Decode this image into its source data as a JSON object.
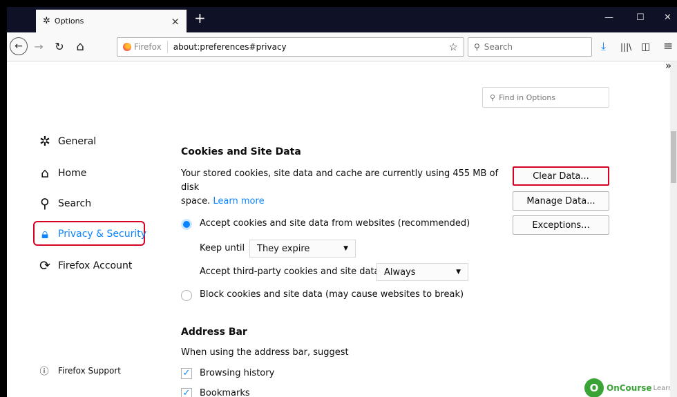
{
  "tab": {
    "icon": "gear-icon",
    "title": "Options",
    "close": "×"
  },
  "newtab": "+",
  "window_controls": {
    "minimize": "—",
    "maximize": "☐",
    "close": "✕"
  },
  "nav": {
    "back": "←",
    "forward": "→",
    "reload": "↻",
    "home": "⌂"
  },
  "urlbar": {
    "identity": "Firefox",
    "url": "about:preferences#privacy",
    "bookmark_star": "☆"
  },
  "searchbar": {
    "placeholder": "Search"
  },
  "toolbar": {
    "download": "⤓",
    "library": "|||\\",
    "sidebar": "◫",
    "menu": "≡",
    "overflow": "»"
  },
  "find": {
    "placeholder": "Find in Options"
  },
  "categories": [
    {
      "label": "General",
      "icon": "gear-icon"
    },
    {
      "label": "Home",
      "icon": "home-icon"
    },
    {
      "label": "Search",
      "icon": "search-icon"
    },
    {
      "label": "Privacy & Security",
      "icon": "lock-icon"
    },
    {
      "label": "Firefox Account",
      "icon": "sync-icon"
    }
  ],
  "support": {
    "label": "Firefox Support",
    "icon": "help-icon"
  },
  "cookies": {
    "heading": "Cookies and Site Data",
    "desc_line1": "Your stored cookies, site data and cache are currently using 455 MB of disk",
    "desc_line2": "space.",
    "learn_more": "Learn more",
    "btn_clear": "Clear Data...",
    "btn_manage": "Manage Data...",
    "btn_exceptions": "Exceptions...",
    "accept_label": "Accept cookies and site data from websites (recommended)",
    "keep_until_label": "Keep until",
    "keep_until_value": "They expire",
    "third_party_label": "Accept third-party cookies and site data",
    "third_party_value": "Always",
    "block_label": "Block cookies and site data (may cause websites to break)"
  },
  "address_bar": {
    "heading": "Address Bar",
    "desc": "When using the address bar, suggest",
    "items": [
      {
        "label": "Browsing history",
        "checked": true
      },
      {
        "label": "Bookmarks",
        "checked": true
      }
    ]
  },
  "watermark": {
    "logo": "O",
    "brand": "OnCourse",
    "suffix": "Learning"
  },
  "colors": {
    "accent": "#0a84ff",
    "highlight": "#d70022",
    "tabbar": "#0f1126"
  }
}
